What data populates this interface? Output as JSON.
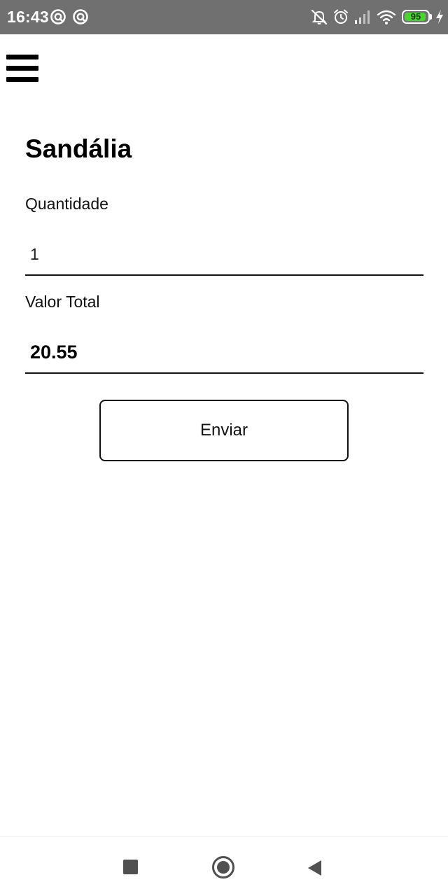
{
  "status_bar": {
    "time": "16:43",
    "left_icons": [
      "app-notification-icon",
      "app-notification-icon"
    ],
    "right_icons": [
      "notifications-muted-icon",
      "alarm-clock-icon",
      "cellular-signal-icon",
      "wifi-icon",
      "battery-icon",
      "charging-bolt-icon"
    ],
    "battery_level": "95",
    "battery_fraction": 0.95,
    "battery_color": "#4cd333",
    "background_color": "#707070"
  },
  "menu": {
    "icon": "hamburger-menu-icon"
  },
  "product": {
    "name": "Sandália"
  },
  "form": {
    "quantity_label": "Quantidade",
    "quantity_value": "1",
    "total_label": "Valor Total",
    "total_value": "20.55",
    "submit_label": "Enviar"
  },
  "nav_bar": {
    "buttons": [
      "recent-apps-icon",
      "home-icon",
      "back-icon"
    ]
  }
}
